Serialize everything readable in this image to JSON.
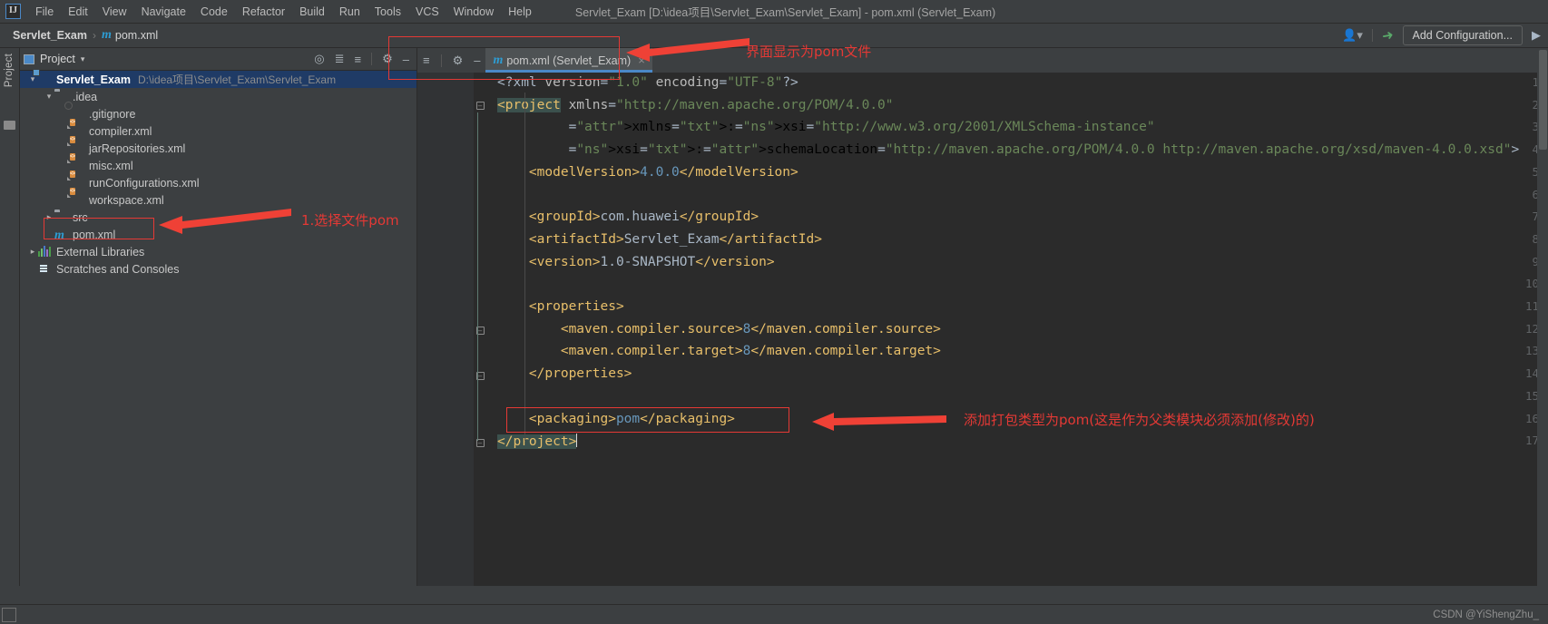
{
  "window": {
    "title": "Servlet_Exam [D:\\idea项目\\Servlet_Exam\\Servlet_Exam] - pom.xml (Servlet_Exam)"
  },
  "menubar": {
    "logo": "IJ",
    "items": [
      {
        "label": "File"
      },
      {
        "label": "Edit"
      },
      {
        "label": "View"
      },
      {
        "label": "Navigate"
      },
      {
        "label": "Code"
      },
      {
        "label": "Refactor"
      },
      {
        "label": "Build"
      },
      {
        "label": "Run"
      },
      {
        "label": "Tools"
      },
      {
        "label": "VCS"
      },
      {
        "label": "Window"
      },
      {
        "label": "Help"
      }
    ]
  },
  "navbar": {
    "crumb_project": "Servlet_Exam",
    "crumb_sep": "›",
    "crumb_file": "pom.xml",
    "maven_glyph": "m",
    "add_configuration": "Add Configuration...",
    "person_icon": "person-icon",
    "hammer_icon": "build-hammer-icon",
    "run_icon": "run-icon"
  },
  "left_strip": {
    "project_label": "Project",
    "folder_icon": "folder-icon"
  },
  "project_panel": {
    "header_title": "Project",
    "header_caret": "▾",
    "tools": [
      "target-icon",
      "collapse-expand-icon",
      "collapse-all-icon",
      "gear-icon",
      "minimize-icon"
    ],
    "tree": [
      {
        "indent": 0,
        "arrow": "open",
        "icon": "module",
        "name": "Servlet_Exam",
        "path": "D:\\idea项目\\Servlet_Exam\\Servlet_Exam",
        "selected": true,
        "bold": true
      },
      {
        "indent": 1,
        "arrow": "open",
        "icon": "folder",
        "name": ".idea",
        "path": "",
        "selected": false,
        "bold": false
      },
      {
        "indent": 2,
        "arrow": "blank",
        "icon": "git",
        "name": ".gitignore",
        "path": "",
        "selected": false,
        "bold": false
      },
      {
        "indent": 2,
        "arrow": "blank",
        "icon": "xml",
        "name": "compiler.xml",
        "path": "",
        "selected": false,
        "bold": false
      },
      {
        "indent": 2,
        "arrow": "blank",
        "icon": "xml",
        "name": "jarRepositories.xml",
        "path": "",
        "selected": false,
        "bold": false
      },
      {
        "indent": 2,
        "arrow": "blank",
        "icon": "xml",
        "name": "misc.xml",
        "path": "",
        "selected": false,
        "bold": false
      },
      {
        "indent": 2,
        "arrow": "blank",
        "icon": "xml",
        "name": "runConfigurations.xml",
        "path": "",
        "selected": false,
        "bold": false
      },
      {
        "indent": 2,
        "arrow": "blank",
        "icon": "xml",
        "name": "workspace.xml",
        "path": "",
        "selected": false,
        "bold": false
      },
      {
        "indent": 1,
        "arrow": "closed",
        "icon": "folder",
        "name": "src",
        "path": "",
        "selected": false,
        "bold": false
      },
      {
        "indent": 1,
        "arrow": "blank",
        "icon": "maven",
        "name": "pom.xml",
        "path": "",
        "selected": false,
        "bold": false
      },
      {
        "indent": 0,
        "arrow": "closed",
        "icon": "lib",
        "name": "External Libraries",
        "path": "",
        "selected": false,
        "bold": false
      },
      {
        "indent": 0,
        "arrow": "blank",
        "icon": "scratch",
        "name": "Scratches and Consoles",
        "path": "",
        "selected": false,
        "bold": false
      }
    ]
  },
  "editor": {
    "tab": {
      "glyph": "m",
      "label": "pom.xml (Servlet_Exam)",
      "close": "×"
    },
    "line_numbers": [
      "1",
      "2",
      "3",
      "4",
      "5",
      "6",
      "7",
      "8",
      "9",
      "10",
      "11",
      "12",
      "13",
      "14",
      "15",
      "16",
      "17"
    ],
    "code": [
      "<?xml version=\"1.0\" encoding=\"UTF-8\"?>",
      "<project xmlns=\"http://maven.apache.org/POM/4.0.0\"",
      "         xmlns:xsi=\"http://www.w3.org/2001/XMLSchema-instance\"",
      "         xsi:schemaLocation=\"http://maven.apache.org/POM/4.0.0 http://maven.apache.org/xsd/maven-4.0.0.xsd\">",
      "    <modelVersion>4.0.0</modelVersion>",
      "",
      "    <groupId>com.huawei</groupId>",
      "    <artifactId>Servlet_Exam</artifactId>",
      "    <version>1.0-SNAPSHOT</version>",
      "",
      "    <properties>",
      "        <maven.compiler.source>8</maven.compiler.source>",
      "        <maven.compiler.target>8</maven.compiler.target>",
      "    </properties>",
      "",
      "    <packaging>pom</packaging>",
      "</project>"
    ]
  },
  "annotations": [
    {
      "id": "anno-tab",
      "text": "界面显示为pom文件"
    },
    {
      "id": "anno-tree",
      "text": "1.选择文件pom"
    },
    {
      "id": "anno-packaging",
      "text": "添加打包类型为pom(这是作为父类模块必须添加(修改)的)"
    }
  ],
  "statusbar": {
    "watermark": "CSDN @YiShengZhu_"
  },
  "colors": {
    "accent_blue": "#4a88c7",
    "annotation_red": "#e53935",
    "selection_blue": "#1f3b66",
    "editor_bg": "#2b2b2b",
    "panel_bg": "#3c3f41"
  }
}
